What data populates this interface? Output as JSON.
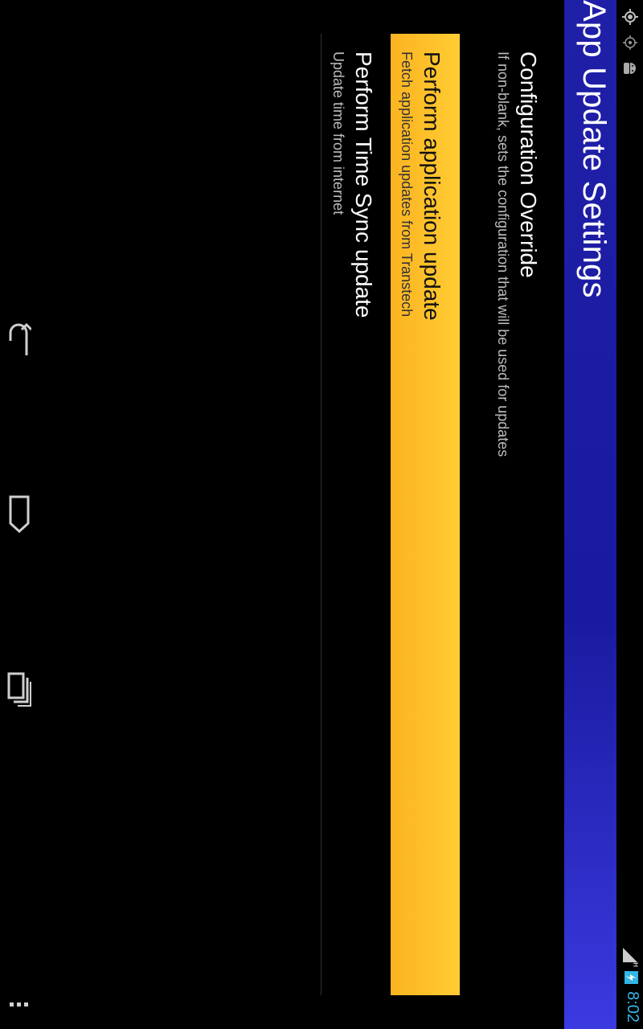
{
  "status_bar": {
    "left_icons": [
      "gps-icon",
      "location-icon",
      "android-icon"
    ],
    "right_icons": [
      "signal-icon",
      "battery-charging-icon"
    ],
    "network_type": "H",
    "time": "8:02",
    "clock_color": "#33b5e5"
  },
  "action_bar": {
    "title": "App Update Settings",
    "background_color": "#1f1fa8"
  },
  "preferences": [
    {
      "title": "Configuration Override",
      "summary": "If non-blank, sets the configuration that will be used for updates",
      "highlighted": false
    },
    {
      "title": "Perform application update",
      "summary": "Fetch application updates from Transtech",
      "highlighted": true,
      "highlight_color": "#fcb421"
    },
    {
      "title": "Perform Time Sync update",
      "summary": "Update time from internet",
      "highlighted": false
    }
  ],
  "navigation_bar": {
    "buttons": [
      "back-icon",
      "home-icon",
      "recent-apps-icon"
    ],
    "menu": "overflow-menu-icon"
  }
}
